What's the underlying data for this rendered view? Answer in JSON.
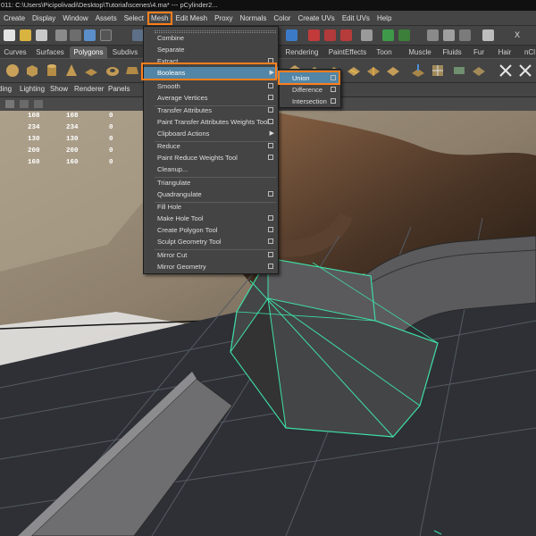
{
  "title_bar": {
    "text": "011: C:\\Users\\Picipolivadi\\Desktop\\Tutorial\\scenes\\4.ma*   ---   pCylinder2..."
  },
  "main_menu": [
    "Create",
    "Display",
    "Window",
    "Assets",
    "Select",
    "Mesh",
    "Edit Mesh",
    "Proxy",
    "Normals",
    "Color",
    "Create UVs",
    "Edit UVs",
    "Help"
  ],
  "toolbar": {
    "x_label": "X"
  },
  "shelf_tabs": [
    "Curves",
    "Surfaces",
    "Polygons",
    "Subdivs",
    "Rendering",
    "PaintEffects",
    "Toon",
    "Muscle",
    "Fluids",
    "Fur",
    "Hair",
    "nCl"
  ],
  "active_shelf_tab": "Polygons",
  "panel_menu": [
    "ding",
    "Lighting",
    "Show",
    "Renderer",
    "Panels"
  ],
  "hud_rows": [
    [
      "108",
      "108",
      "0"
    ],
    [
      "234",
      "234",
      "0"
    ],
    [
      "130",
      "130",
      "0"
    ],
    [
      "200",
      "200",
      "0"
    ],
    [
      "160",
      "160",
      "0"
    ]
  ],
  "mesh_menu": {
    "items": [
      {
        "label": "Combine",
        "option_box": false
      },
      {
        "label": "Separate",
        "option_box": false
      },
      {
        "label": "Extract",
        "option_box": true
      },
      {
        "label": "Booleans",
        "submenu": true,
        "highlighted": true
      },
      {
        "label": "Smooth",
        "option_box": true
      },
      {
        "label": "Average Vertices",
        "option_box": true
      },
      {
        "label": "Transfer Attributes",
        "option_box": true
      },
      {
        "label": "Paint Transfer Attributes Weights Tool",
        "option_box": true
      },
      {
        "label": "Clipboard Actions",
        "submenu": true
      },
      {
        "label": "Reduce",
        "option_box": true
      },
      {
        "label": "Paint Reduce Weights Tool",
        "option_box": true
      },
      {
        "label": "Cleanup...",
        "option_box": false
      },
      {
        "label": "Triangulate",
        "option_box": false
      },
      {
        "label": "Quadrangulate",
        "option_box": true
      },
      {
        "label": "Fill Hole",
        "option_box": false
      },
      {
        "label": "Make Hole Tool",
        "option_box": true
      },
      {
        "label": "Create Polygon Tool",
        "option_box": true
      },
      {
        "label": "Sculpt Geometry Tool",
        "option_box": true
      },
      {
        "label": "Mirror Cut",
        "option_box": true
      },
      {
        "label": "Mirror Geometry",
        "option_box": true
      }
    ]
  },
  "booleans_submenu": {
    "items": [
      {
        "label": "Union",
        "option_box": true,
        "highlighted": true
      },
      {
        "label": "Difference",
        "option_box": true
      },
      {
        "label": "Intersection",
        "option_box": true
      }
    ]
  },
  "colors": {
    "highlight": "#5285a6",
    "callout_outline": "#ff7f1c",
    "selection_wire": "#3ee0a6"
  }
}
